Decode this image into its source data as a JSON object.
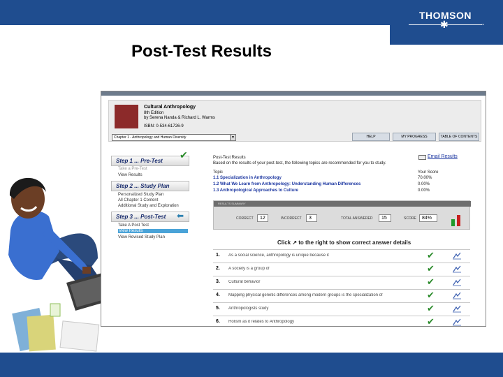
{
  "slide": {
    "title": "Post-Test Results",
    "logo": "THOMSON",
    "logo_mark": "™",
    "logo_icon": "star-icon"
  },
  "book": {
    "title": "Cultural Anthropology",
    "edition": "8th Edition",
    "authors": "by Serena Nanda & Richard L. Warms",
    "isbn": "ISBN: 0-534-61726-9",
    "chapter_select": "Chapter 1 - Anthropology and Human Diversity"
  },
  "header_buttons": {
    "help": "HELP",
    "progress": "MY PROGRESS",
    "toc": "TABLE OF CONTENTS"
  },
  "nav": {
    "step1": {
      "title": "Step 1 ... Pre-Test",
      "links": [
        "Take a Pre-Test",
        "View Results"
      ]
    },
    "step2": {
      "title": "Step 2 ... Study Plan",
      "links": [
        "Personalized Study Plan",
        "All Chapter 1 Content",
        "Additional Study and Exploration"
      ]
    },
    "step3": {
      "title": "Step 3 ... Post-Test",
      "links": [
        "Take A Post Test",
        "View Results",
        "View Revised Study Plan"
      ]
    }
  },
  "results": {
    "heading": "Post-Test Results",
    "intro": "Based on the results of your post-test, the following topics are recommended for you to study.",
    "email_label": "Email Results",
    "topic_header": "Topic",
    "score_header": "Your Score",
    "topics": [
      {
        "label": "1.1 Specialization in Anthropology",
        "score": "70.00%"
      },
      {
        "label": "1.2 What We Learn from Anthropology: Understanding Human Differences",
        "score": "0.00%"
      },
      {
        "label": "1.3 Anthropological Approaches to Culture",
        "score": "0.00%"
      }
    ]
  },
  "summary": {
    "tab_label": "RESULTS SUMMARY",
    "correct_label": "CORRECT",
    "correct": "12",
    "incorrect_label": "INCORRECT",
    "incorrect": "3",
    "total_label": "TOTAL ANSWERED",
    "total": "15",
    "score_label": "SCORE",
    "score": "84%",
    "score_bars": {
      "correct_fraction": 0.8,
      "incorrect_fraction": 0.2,
      "colors": {
        "correct": "#1f9a2a",
        "incorrect": "#c8201f"
      }
    }
  },
  "answers": {
    "instruction": "Click ↗ to the right to show correct answer details",
    "questions": [
      {
        "num": "1.",
        "text": "As a social science, anthropology is unique because it"
      },
      {
        "num": "2.",
        "text": "A society is a group of"
      },
      {
        "num": "3.",
        "text": "Cultural behavior"
      },
      {
        "num": "4.",
        "text": "Mapping physical genetic differences among modern groups is the specialization of"
      },
      {
        "num": "5.",
        "text": "Anthropologists study"
      },
      {
        "num": "6.",
        "text": "Holism as it relates to Anthropology"
      }
    ]
  },
  "colors": {
    "brand_blue": "#1f4d8f",
    "link_blue": "#1a35a0",
    "active_nav": "#4aa3d8",
    "check_green": "#2a8a2a"
  }
}
